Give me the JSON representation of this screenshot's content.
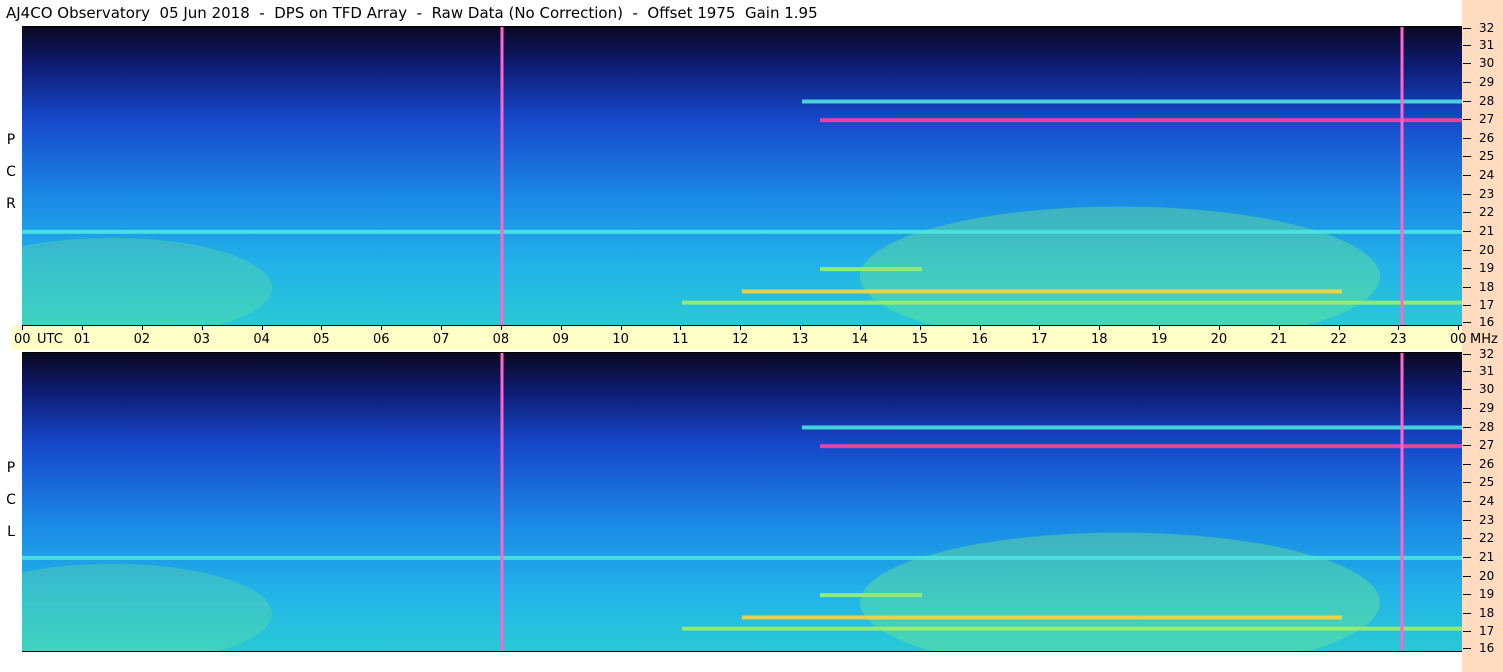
{
  "title": "AJ4CO Observatory  05 Jun 2018  -  DPS on TFD Array  -  Raw Data (No Correction)  -  Offset 1975  Gain 1.95",
  "panels": [
    {
      "id": "rcp",
      "letters": [
        "P",
        "C",
        "R"
      ]
    },
    {
      "id": "lcp",
      "letters": [
        "P",
        "C",
        "L"
      ]
    }
  ],
  "time_unit": "UTC",
  "freq_unit": "MHz",
  "colors": {
    "axis_strip": "#ffffc8",
    "freq_strip": "#ffdcc0",
    "marker_line": "#ff66cc"
  },
  "chart_data": [
    {
      "type": "heatmap",
      "series_label": "RCP",
      "x_ticks": [
        "00",
        "01",
        "02",
        "03",
        "04",
        "05",
        "06",
        "07",
        "08",
        "09",
        "10",
        "11",
        "12",
        "13",
        "14",
        "15",
        "16",
        "17",
        "18",
        "19",
        "20",
        "21",
        "22",
        "23",
        "00"
      ],
      "x_range_hours": [
        0,
        24
      ],
      "y_ticks": [
        32,
        31,
        30,
        29,
        28,
        27,
        26,
        25,
        24,
        23,
        22,
        21,
        20,
        19,
        18,
        17,
        16
      ],
      "y_range_mhz": [
        16,
        32
      ],
      "markers_hours": [
        8,
        23
      ],
      "bands": [
        {
          "mhz": 27.0,
          "start_h": 13.3,
          "end_h": 24,
          "intensity": 0.95
        },
        {
          "mhz": 17.8,
          "start_h": 12.0,
          "end_h": 22.0,
          "intensity": 0.7
        },
        {
          "mhz": 17.2,
          "start_h": 11.0,
          "end_h": 24,
          "intensity": 0.6
        },
        {
          "mhz": 19.0,
          "start_h": 13.3,
          "end_h": 15.0,
          "intensity": 0.5
        },
        {
          "mhz": 28.0,
          "start_h": 13.0,
          "end_h": 24,
          "intensity": 0.4
        },
        {
          "mhz": 21.0,
          "start_h": 0.0,
          "end_h": 24,
          "intensity": 0.3
        }
      ]
    },
    {
      "type": "heatmap",
      "series_label": "LCP",
      "x_ticks": [
        "00",
        "01",
        "02",
        "03",
        "04",
        "05",
        "06",
        "07",
        "08",
        "09",
        "10",
        "11",
        "12",
        "13",
        "14",
        "15",
        "16",
        "17",
        "18",
        "19",
        "20",
        "21",
        "22",
        "23",
        "00"
      ],
      "x_range_hours": [
        0,
        24
      ],
      "y_ticks": [
        32,
        31,
        30,
        29,
        28,
        27,
        26,
        25,
        24,
        23,
        22,
        21,
        20,
        19,
        18,
        17,
        16
      ],
      "y_range_mhz": [
        16,
        32
      ],
      "markers_hours": [
        8,
        23
      ],
      "bands": [
        {
          "mhz": 27.0,
          "start_h": 13.3,
          "end_h": 24,
          "intensity": 0.95
        },
        {
          "mhz": 17.8,
          "start_h": 12.0,
          "end_h": 22.0,
          "intensity": 0.7
        },
        {
          "mhz": 17.2,
          "start_h": 11.0,
          "end_h": 24,
          "intensity": 0.6
        },
        {
          "mhz": 19.0,
          "start_h": 13.3,
          "end_h": 15.0,
          "intensity": 0.5
        },
        {
          "mhz": 28.0,
          "start_h": 13.0,
          "end_h": 24,
          "intensity": 0.4
        },
        {
          "mhz": 21.0,
          "start_h": 0.0,
          "end_h": 24,
          "intensity": 0.3
        }
      ]
    }
  ]
}
